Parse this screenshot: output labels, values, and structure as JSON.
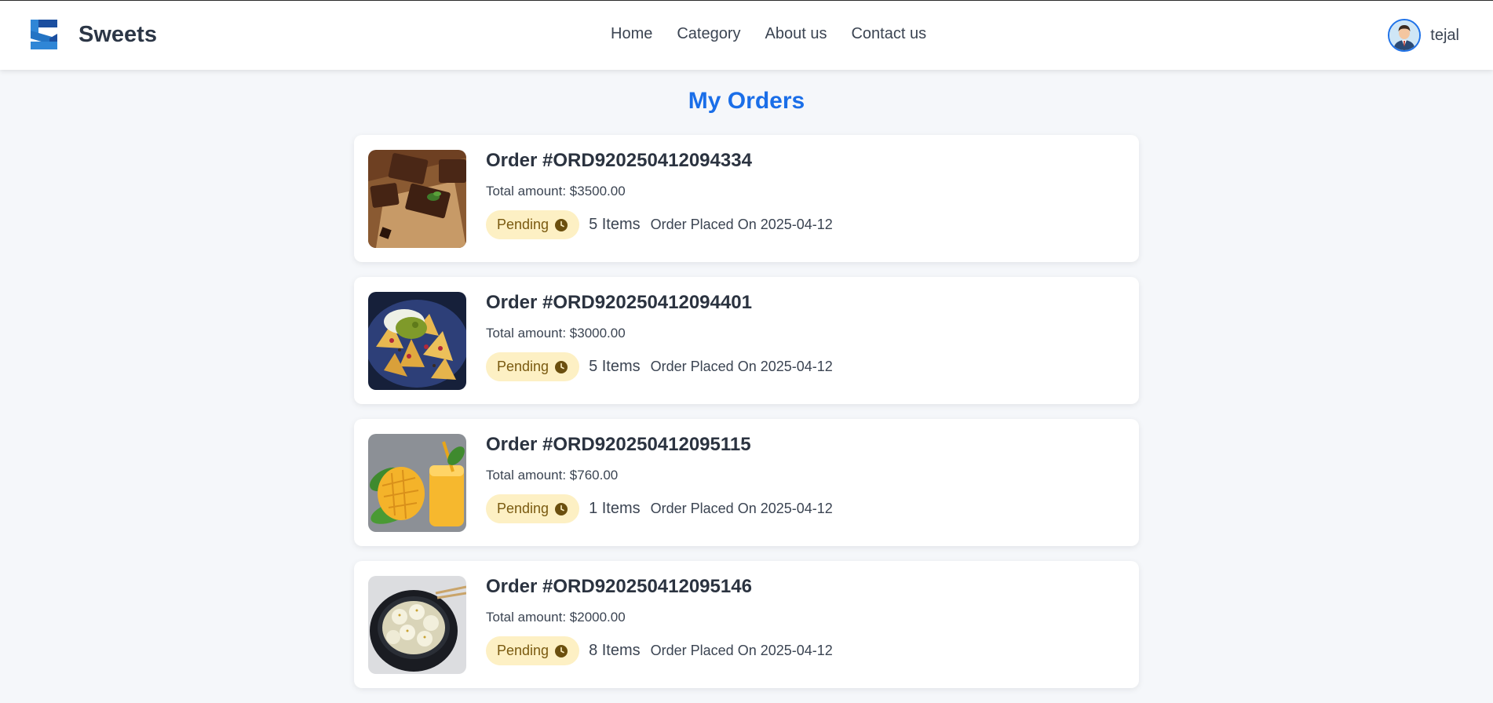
{
  "brand": {
    "name": "Sweets",
    "logo_icon": "brand-s-logo-icon",
    "logo_colors": [
      "#1b4fa0",
      "#2f86d6"
    ]
  },
  "nav": {
    "items": [
      {
        "label": "Home"
      },
      {
        "label": "Category"
      },
      {
        "label": "About us"
      },
      {
        "label": "Contact us"
      }
    ]
  },
  "user": {
    "name": "tejal",
    "avatar_icon": "user-avatar-icon"
  },
  "page": {
    "title": "My Orders"
  },
  "colors": {
    "accent": "#1a6ee8",
    "pending_bg": "#fdf0c4",
    "pending_text": "#7a5a10"
  },
  "orders": [
    {
      "id": "Order #ORD920250412094334",
      "total": "Total amount: $3500.00",
      "status": "Pending",
      "items": "5 Items",
      "placed": "Order Placed On 2025-04-12",
      "image": "brownies"
    },
    {
      "id": "Order #ORD920250412094401",
      "total": "Total amount: $3000.00",
      "status": "Pending",
      "items": "5 Items",
      "placed": "Order Placed On 2025-04-12",
      "image": "nachos"
    },
    {
      "id": "Order #ORD920250412095115",
      "total": "Total amount: $760.00",
      "status": "Pending",
      "items": "1 Items",
      "placed": "Order Placed On 2025-04-12",
      "image": "mango-juice"
    },
    {
      "id": "Order #ORD920250412095146",
      "total": "Total amount: $2000.00",
      "status": "Pending",
      "items": "8 Items",
      "placed": "Order Placed On 2025-04-12",
      "image": "rasgulla"
    }
  ]
}
